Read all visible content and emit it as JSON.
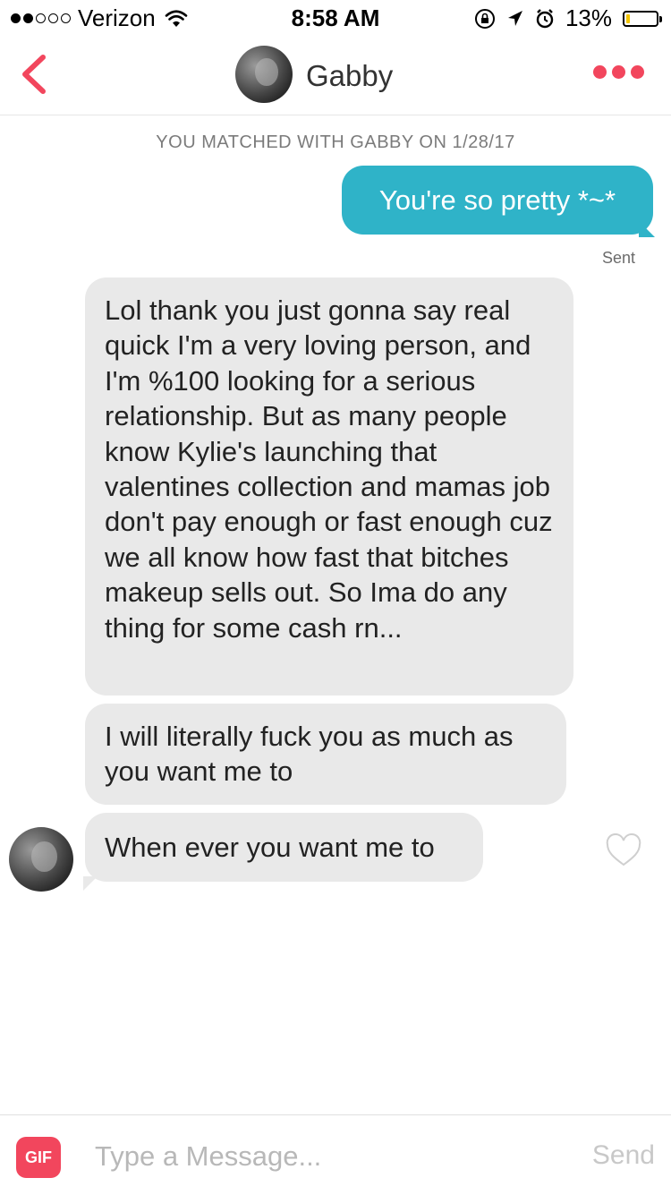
{
  "status_bar": {
    "carrier": "Verizon",
    "time": "8:58 AM",
    "battery_percent": "13%",
    "battery_level": 0.13,
    "signal_bars_filled": 2,
    "signal_bars_total": 5
  },
  "header": {
    "contact_name": "Gabby"
  },
  "conversation": {
    "matched_notice": "YOU MATCHED WITH GABBY ON 1/28/17",
    "messages": [
      {
        "from": "me",
        "text": "You're so pretty *~*",
        "status": "Sent"
      },
      {
        "from": "them",
        "text": "Lol thank you just gonna say real quick I'm a very loving person, and I'm %100 looking for a serious relationship. But as many people know Kylie's launching that valentines collection and mamas job don't pay enough or fast enough cuz we all know how fast that bitches makeup sells out. So Ima do any thing for some cash rn..."
      },
      {
        "from": "them",
        "text": "I will literally fuck you as much as you want me to"
      },
      {
        "from": "them",
        "text": "When ever you want me to"
      }
    ]
  },
  "composer": {
    "gif_label": "GIF",
    "placeholder": "Type a Message...",
    "send_label": "Send"
  },
  "colors": {
    "brand": "#f2465d",
    "sent_bubble": "#2fb3c8",
    "received_bubble": "#e9e9e9",
    "battery_low": "#f2c500"
  },
  "icons": [
    "wifi-icon",
    "orientation-lock-icon",
    "location-arrow-icon",
    "alarm-icon",
    "battery-icon",
    "back-chevron-icon",
    "more-dots-icon",
    "heart-outline-icon"
  ]
}
